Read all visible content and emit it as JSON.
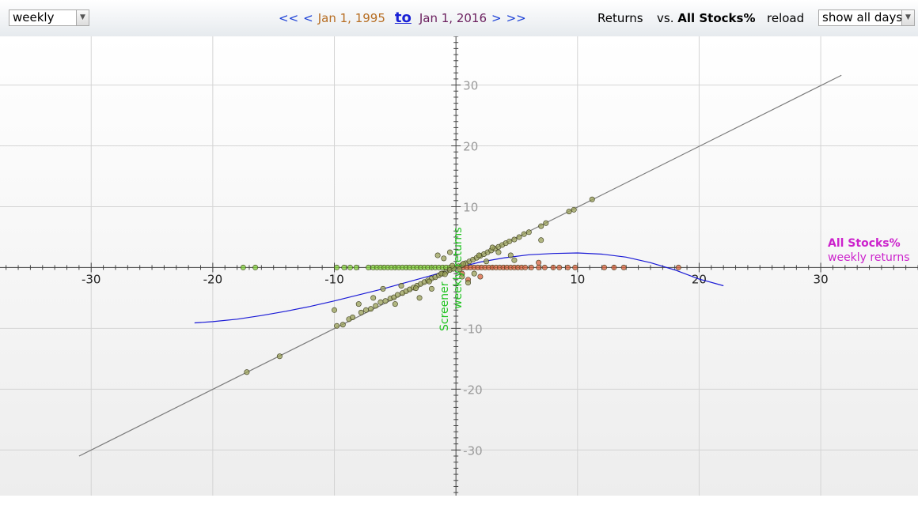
{
  "toolbar": {
    "period_select": "weekly",
    "nav_first": "<<",
    "nav_prev": "<",
    "date_from": "Jan 1, 1995",
    "to_label": "to",
    "date_to": "Jan 1, 2016",
    "nav_next": ">",
    "nav_last": ">>",
    "returns_label": "Returns",
    "vs_label": "vs.",
    "benchmark": "All Stocks%",
    "reload_label": "reload",
    "days_select": "show all days"
  },
  "colors": {
    "nav_link": "#1a3fd6",
    "date_from": "#b76e23",
    "date_to": "#6b1f5e",
    "x_label": "#cc22cc",
    "y_label": "#22c422",
    "fit_curve": "#1a1ad6",
    "identity_line": "#7a7a7a",
    "point_both": "#9aa05a",
    "point_y_only": "#7fcf3a",
    "point_x_only": "#d8623f",
    "axis": "#444444",
    "tick_label": "#999999"
  },
  "chart_data": {
    "type": "scatter",
    "xlabel": "All Stocks%",
    "xlabel_sub": "weekly returns",
    "ylabel": "Screener",
    "ylabel_sub": "weekly returns",
    "xlim": [
      -37.5,
      38
    ],
    "ylim": [
      -37.5,
      38
    ],
    "x_ticks": [
      -30,
      -20,
      -10,
      10,
      20,
      30
    ],
    "y_ticks": [
      30,
      20,
      10,
      -10,
      -20,
      -30
    ],
    "grid": true,
    "series": [
      {
        "kind": "points_both",
        "points": [
          [
            -17.2,
            -17.2
          ],
          [
            -14.5,
            -14.6
          ],
          [
            -9.8,
            -9.6
          ],
          [
            -9.3,
            -9.4
          ],
          [
            -8.8,
            -8.5
          ],
          [
            -8.5,
            -8.2
          ],
          [
            -7.8,
            -7.4
          ],
          [
            -7.4,
            -7.0
          ],
          [
            -7.0,
            -6.8
          ],
          [
            -6.6,
            -6.3
          ],
          [
            -6.2,
            -5.7
          ],
          [
            -5.8,
            -5.5
          ],
          [
            -5.4,
            -5.1
          ],
          [
            -5.1,
            -4.9
          ],
          [
            -4.8,
            -4.5
          ],
          [
            -4.4,
            -4.2
          ],
          [
            -4.1,
            -3.9
          ],
          [
            -3.8,
            -3.6
          ],
          [
            -3.5,
            -3.3
          ],
          [
            -3.2,
            -3.0
          ],
          [
            -2.9,
            -2.7
          ],
          [
            -2.6,
            -2.4
          ],
          [
            -2.3,
            -2.1
          ],
          [
            -2.0,
            -1.8
          ],
          [
            -1.7,
            -1.6
          ],
          [
            -1.4,
            -1.3
          ],
          [
            -1.1,
            -1.0
          ],
          [
            -0.8,
            -0.7
          ],
          [
            -0.5,
            -0.4
          ],
          [
            -0.2,
            -0.2
          ],
          [
            0.2,
            0.2
          ],
          [
            0.5,
            0.4
          ],
          [
            0.8,
            0.7
          ],
          [
            1.1,
            1.0
          ],
          [
            1.4,
            1.3
          ],
          [
            1.7,
            1.6
          ],
          [
            2.0,
            1.9
          ],
          [
            2.3,
            2.2
          ],
          [
            2.6,
            2.5
          ],
          [
            2.9,
            2.8
          ],
          [
            3.2,
            3.1
          ],
          [
            3.5,
            3.4
          ],
          [
            3.8,
            3.7
          ],
          [
            4.1,
            4.0
          ],
          [
            4.4,
            4.3
          ],
          [
            4.8,
            4.6
          ],
          [
            5.2,
            5.0
          ],
          [
            5.6,
            5.5
          ],
          [
            6.0,
            5.8
          ],
          [
            7.0,
            6.8
          ],
          [
            7.4,
            7.3
          ],
          [
            9.3,
            9.2
          ],
          [
            9.7,
            9.5
          ],
          [
            11.2,
            11.2
          ],
          [
            -10.0,
            -7.0
          ],
          [
            -8.0,
            -6.0
          ],
          [
            -6.8,
            -5.0
          ],
          [
            -5.0,
            -6.0
          ],
          [
            -6.0,
            -3.5
          ],
          [
            -4.5,
            -3.0
          ],
          [
            -3.0,
            -5.0
          ],
          [
            -2.0,
            -3.5
          ],
          [
            -1.5,
            2.0
          ],
          [
            -1.0,
            1.5
          ],
          [
            -0.5,
            2.5
          ],
          [
            0.5,
            -1.5
          ],
          [
            1.0,
            -2.5
          ],
          [
            1.5,
            -1.0
          ],
          [
            2.5,
            1.0
          ],
          [
            3.5,
            2.5
          ],
          [
            4.5,
            2.0
          ],
          [
            4.8,
            1.2
          ],
          [
            7.0,
            4.5
          ],
          [
            -1.2,
            -1.0
          ],
          [
            0.6,
            0.6
          ],
          [
            -3.3,
            -3.4
          ],
          [
            -2.2,
            -2.3
          ],
          [
            1.9,
            2.0
          ],
          [
            3.0,
            3.3
          ],
          [
            -0.9,
            -1.1
          ],
          [
            0.3,
            -0.3
          ],
          [
            -0.3,
            0.3
          ]
        ]
      },
      {
        "kind": "points_y_only",
        "points": [
          [
            -17.5,
            0
          ],
          [
            -16.5,
            0
          ],
          [
            -9.8,
            0
          ],
          [
            -9.2,
            0
          ],
          [
            -8.7,
            0
          ],
          [
            -8.2,
            0
          ],
          [
            -7.2,
            0
          ],
          [
            -6.8,
            0
          ],
          [
            -6.5,
            0
          ],
          [
            -6.2,
            0
          ],
          [
            -5.9,
            0
          ],
          [
            -5.6,
            0
          ],
          [
            -5.3,
            0
          ],
          [
            -5.0,
            0
          ],
          [
            -4.7,
            0
          ],
          [
            -4.4,
            0
          ],
          [
            -4.1,
            0
          ],
          [
            -3.8,
            0
          ],
          [
            -3.5,
            0
          ],
          [
            -3.2,
            0
          ],
          [
            -2.9,
            0
          ],
          [
            -2.6,
            0
          ],
          [
            -2.3,
            0
          ],
          [
            -2.0,
            0
          ],
          [
            -1.7,
            0
          ],
          [
            -1.4,
            0
          ],
          [
            -1.1,
            0
          ],
          [
            -0.8,
            0
          ],
          [
            -0.5,
            0
          ],
          [
            -0.2,
            0
          ]
        ]
      },
      {
        "kind": "points_x_only",
        "points": [
          [
            0.3,
            0
          ],
          [
            0.6,
            0
          ],
          [
            0.9,
            0
          ],
          [
            1.2,
            0
          ],
          [
            1.5,
            0
          ],
          [
            1.8,
            0
          ],
          [
            2.1,
            0
          ],
          [
            2.4,
            0
          ],
          [
            2.7,
            0
          ],
          [
            3.0,
            0
          ],
          [
            3.3,
            0
          ],
          [
            3.6,
            0
          ],
          [
            3.9,
            0
          ],
          [
            4.2,
            0
          ],
          [
            4.5,
            0
          ],
          [
            4.8,
            0
          ],
          [
            5.1,
            0
          ],
          [
            5.4,
            0
          ],
          [
            5.7,
            0
          ],
          [
            6.2,
            0
          ],
          [
            6.8,
            0
          ],
          [
            7.3,
            0
          ],
          [
            8.0,
            0
          ],
          [
            8.5,
            0
          ],
          [
            9.2,
            0
          ],
          [
            9.8,
            0
          ],
          [
            12.2,
            0
          ],
          [
            13.0,
            0
          ],
          [
            13.8,
            0
          ],
          [
            18.3,
            0
          ],
          [
            1.0,
            -2.0
          ],
          [
            2.0,
            -1.5
          ],
          [
            0.5,
            -1.0
          ],
          [
            6.8,
            0.8
          ]
        ]
      },
      {
        "kind": "identity_line",
        "points": [
          [
            -31,
            -31
          ],
          [
            31.7,
            31.6
          ]
        ]
      },
      {
        "kind": "fit_curve",
        "points": [
          [
            -21.5,
            -9.1
          ],
          [
            -20,
            -8.9
          ],
          [
            -18,
            -8.5
          ],
          [
            -16,
            -7.9
          ],
          [
            -14,
            -7.2
          ],
          [
            -12,
            -6.4
          ],
          [
            -10,
            -5.5
          ],
          [
            -8,
            -4.5
          ],
          [
            -6,
            -3.5
          ],
          [
            -4,
            -2.4
          ],
          [
            -2,
            -1.3
          ],
          [
            0,
            -0.1
          ],
          [
            2,
            0.9
          ],
          [
            4,
            1.6
          ],
          [
            6,
            2.1
          ],
          [
            8,
            2.3
          ],
          [
            10,
            2.4
          ],
          [
            12,
            2.2
          ],
          [
            14,
            1.7
          ],
          [
            16,
            0.8
          ],
          [
            18,
            -0.4
          ],
          [
            20,
            -1.9
          ],
          [
            22,
            -3.0
          ]
        ]
      }
    ]
  }
}
